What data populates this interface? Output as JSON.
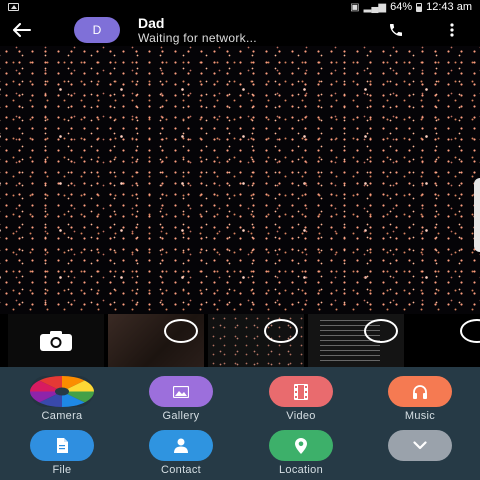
{
  "status_bar": {
    "battery": "64%",
    "time": "12:43 am"
  },
  "app_bar": {
    "avatar_letter": "D",
    "contact_name": "Dad",
    "contact_status": "Waiting for network..."
  },
  "attachments": [
    {
      "label": "Camera",
      "color": "multicolor",
      "icon": "camera-aperture-icon"
    },
    {
      "label": "Gallery",
      "color": "#9c6fdc",
      "icon": "image-icon"
    },
    {
      "label": "Video",
      "color": "#e96b6e",
      "icon": "film-icon"
    },
    {
      "label": "Music",
      "color": "#f57a52",
      "icon": "headphones-icon"
    },
    {
      "label": "File",
      "color": "#2f8fe0",
      "icon": "file-icon"
    },
    {
      "label": "Contact",
      "color": "#2f94e0",
      "icon": "person-icon"
    },
    {
      "label": "Location",
      "color": "#3db06a",
      "icon": "location-pin-icon"
    },
    {
      "label": "",
      "color": "#9aa2ab",
      "icon": "chevron-down-icon"
    }
  ]
}
